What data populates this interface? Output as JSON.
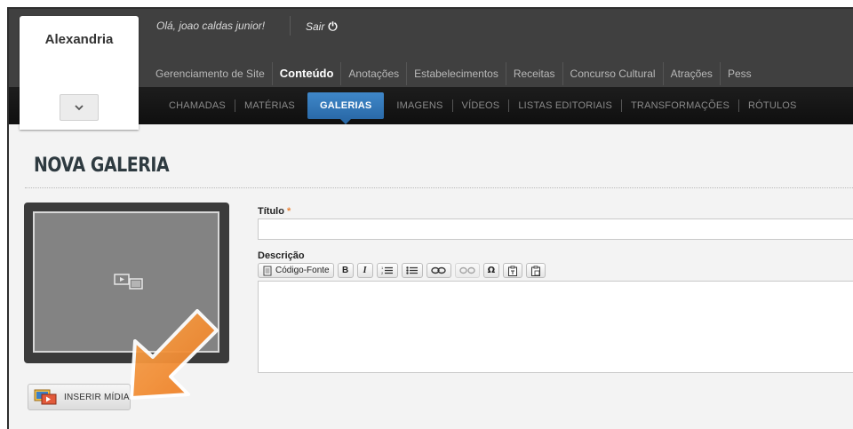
{
  "header": {
    "greeting": "Olá, joao caldas junior!",
    "logout_label": "Sair",
    "logout_icon": "power-icon"
  },
  "site_selector": {
    "name": "Alexandria",
    "caret_icon": "chevron-down-icon"
  },
  "main_nav": {
    "items": [
      {
        "label": "Gerenciamento de Site"
      },
      {
        "label": "Conteúdo",
        "active": true
      },
      {
        "label": "Anotações"
      },
      {
        "label": "Estabelecimentos"
      },
      {
        "label": "Receitas"
      },
      {
        "label": "Concurso Cultural"
      },
      {
        "label": "Atrações"
      },
      {
        "label": "Pess"
      }
    ]
  },
  "sub_nav": {
    "items": [
      {
        "label": "CHAMADAS"
      },
      {
        "label": "MATÉRIAS"
      },
      {
        "label": "GALERIAS",
        "active": true
      },
      {
        "label": "IMAGENS"
      },
      {
        "label": "VÍDEOS"
      },
      {
        "label": "LISTAS EDITORIAIS"
      },
      {
        "label": "TRANSFORMAÇÕES"
      },
      {
        "label": "RÓTULOS"
      }
    ]
  },
  "page": {
    "title": "NOVA GALERIA"
  },
  "media": {
    "insert_label": "INSERIR MÍDIA",
    "placeholder_icon": "media-placeholder-icon"
  },
  "form": {
    "title_label": "Título",
    "required_mark": "*",
    "title_value": "",
    "description_label": "Descrição",
    "toolbar": {
      "source_label": "Código-Fonte",
      "bold_label": "B",
      "italic_label": "I",
      "icons": [
        "ordered-list-icon",
        "bullet-list-icon",
        "link-icon",
        "unlink-icon",
        "special-char-icon",
        "paste-text-icon",
        "paste-word-icon"
      ]
    },
    "description_value": ""
  },
  "colors": {
    "accent": "#2a6aa8",
    "arrow": "#f0852d",
    "header_bg": "#404040",
    "subnav_bg": "#141414"
  }
}
